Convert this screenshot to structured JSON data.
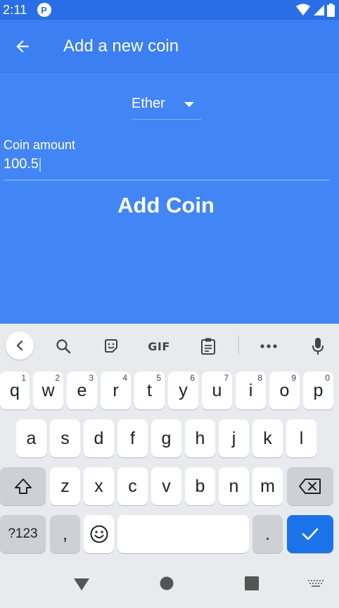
{
  "status_bar": {
    "time": "2:11",
    "app_icon_letter": "P"
  },
  "app_bar": {
    "title": "Add a new coin"
  },
  "coin_select": {
    "selected": "Ether"
  },
  "amount_field": {
    "label": "Coin amount",
    "value": "100.5"
  },
  "add_button": {
    "label": "Add Coin"
  },
  "keyboard": {
    "toolbar": {
      "back": "chevron-left-icon",
      "search": "search-icon",
      "sticker": "sticker-icon",
      "gif": "GIF",
      "clipboard": "clipboard-icon",
      "more": "more-horizontal-icon",
      "mic": "microphone-icon"
    },
    "row1": [
      {
        "key": "q",
        "hint": "1"
      },
      {
        "key": "w",
        "hint": "2"
      },
      {
        "key": "e",
        "hint": "3"
      },
      {
        "key": "r",
        "hint": "4"
      },
      {
        "key": "t",
        "hint": "5"
      },
      {
        "key": "y",
        "hint": "6"
      },
      {
        "key": "u",
        "hint": "7"
      },
      {
        "key": "i",
        "hint": "8"
      },
      {
        "key": "o",
        "hint": "9"
      },
      {
        "key": "p",
        "hint": "0"
      }
    ],
    "row2": [
      "a",
      "s",
      "d",
      "f",
      "g",
      "h",
      "j",
      "k",
      "l"
    ],
    "row3": [
      "z",
      "x",
      "c",
      "v",
      "b",
      "n",
      "m"
    ],
    "symbols_label": "?123",
    "comma_label": ",",
    "period_label": ".",
    "colors": {
      "accent": "#1a73e8",
      "background": "#e8eaed"
    }
  },
  "colors": {
    "app_bar": "#3b7ff2",
    "content": "#4285f4",
    "status_bar": "#2a6ee6"
  }
}
